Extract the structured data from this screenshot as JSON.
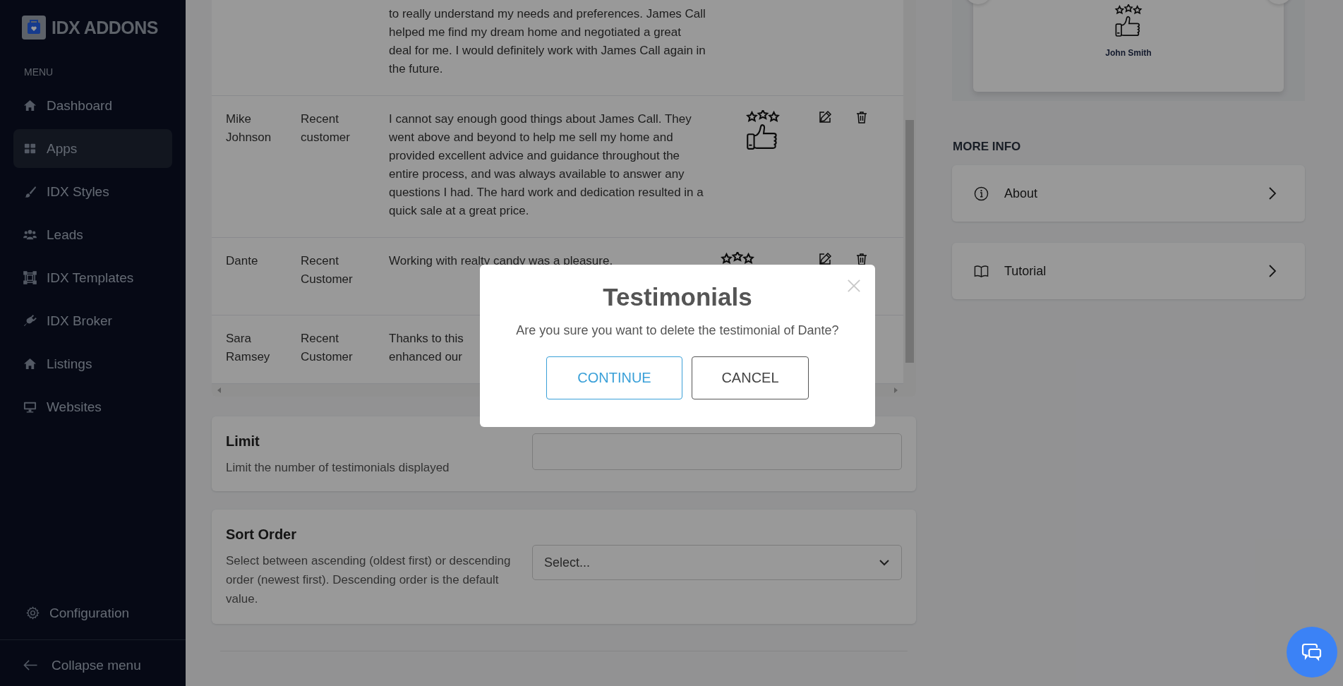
{
  "sidebar": {
    "logo": "IDX ADDONS",
    "menu_label": "MENU",
    "items": [
      {
        "label": "Dashboard",
        "selected": false
      },
      {
        "label": "Apps",
        "selected": true
      },
      {
        "label": "IDX Styles",
        "selected": false
      },
      {
        "label": "Leads",
        "selected": false
      },
      {
        "label": "IDX Templates",
        "selected": false
      },
      {
        "label": "IDX Broker",
        "selected": false
      },
      {
        "label": "Listings",
        "selected": false
      },
      {
        "label": "Websites",
        "selected": false
      }
    ],
    "configuration": "Configuration",
    "collapse": "Collapse menu"
  },
  "table": {
    "rows": [
      {
        "name": "",
        "type": "",
        "text_lines": [
          "to really understand my needs and preferences. James Call",
          "helped me find my dream home and negotiated a great",
          "deal for me. I would definitely work with James Call again in",
          "the future."
        ],
        "image": false,
        "actions": false
      },
      {
        "name": "Mike Johnson",
        "type": "Recent customer",
        "text_lines": [
          "I cannot say enough good things about James Call. They",
          "went above and beyond to help me sell my home and",
          "provided excellent advice and guidance throughout the",
          "entire process, and was always available to answer any",
          "questions I had. The hard work and dedication resulted in a",
          "quick sale at a great price."
        ],
        "image": true,
        "actions": true
      },
      {
        "name": "Dante",
        "type": "Recent Customer",
        "text_lines": [
          "Working with realty candy was a pleasure."
        ],
        "image": true,
        "actions": true
      },
      {
        "name": "Sara Ramsey",
        "type": "Recent Customer",
        "text_lines": [
          "Thanks to this",
          "enhanced our"
        ]
      }
    ]
  },
  "settings": [
    {
      "kind": "input",
      "title": "Limit",
      "description": "Limit the number of testimonials displayed"
    },
    {
      "kind": "select",
      "title": "Sort Order",
      "description": "Select between ascending (oldest first) or descending order (newest first). Descending order is the default value.",
      "placeholder": "Select..."
    }
  ],
  "preview": {
    "name": "John Smith"
  },
  "more_info": {
    "heading": "MORE INFO",
    "items": [
      {
        "label": "About"
      },
      {
        "label": "Tutorial"
      }
    ]
  },
  "modal": {
    "title": "Testimonials",
    "message": "Are you sure you want to delete the testimonial of Dante?",
    "buttons": [
      {
        "label": "CONTINUE",
        "kind": "primary"
      },
      {
        "label": "CANCEL",
        "kind": "secondary"
      }
    ]
  }
}
